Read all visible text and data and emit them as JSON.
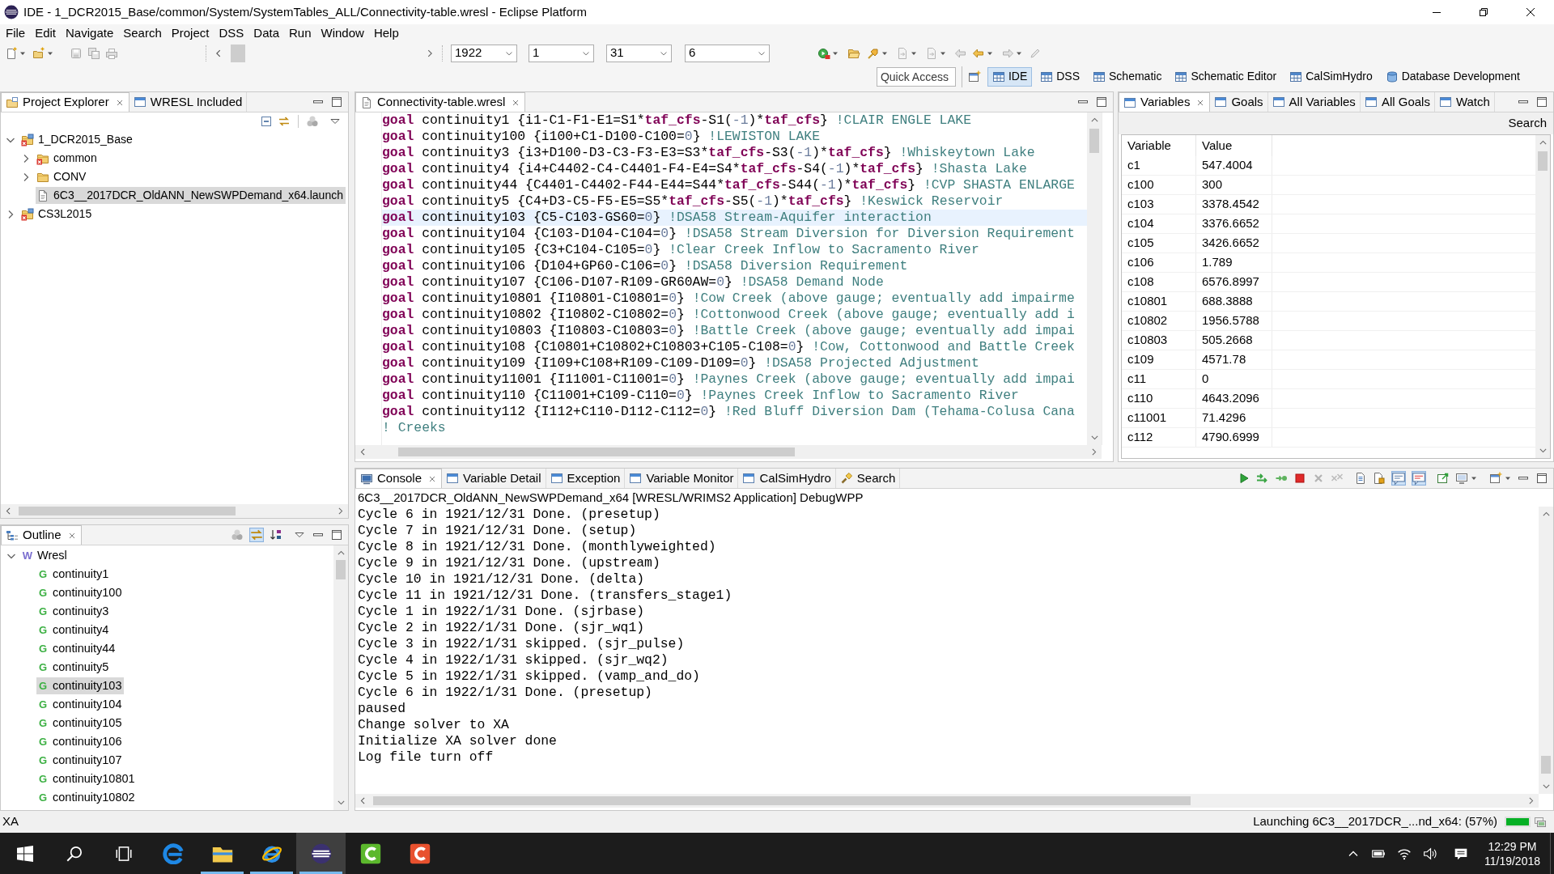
{
  "window": {
    "title": "IDE - 1_DCR2015_Base/common/System/SystemTables_ALL/Connectivity-table.wresl - Eclipse Platform"
  },
  "menu": [
    "File",
    "Edit",
    "Navigate",
    "Search",
    "Project",
    "DSS",
    "Data",
    "Run",
    "Window",
    "Help"
  ],
  "toolbar": {
    "combos": [
      "1922",
      "1",
      "31",
      "6"
    ]
  },
  "perspective_bar": {
    "quick_access": {
      "placeholder": "Quick Access"
    },
    "perspectives": [
      {
        "label": "IDE",
        "kind": "table",
        "selected": true
      },
      {
        "label": "DSS",
        "kind": "table",
        "selected": false
      },
      {
        "label": "Schematic",
        "kind": "table",
        "selected": false
      },
      {
        "label": "Schematic Editor",
        "kind": "table",
        "selected": false
      },
      {
        "label": "CalSimHydro",
        "kind": "table",
        "selected": false
      },
      {
        "label": "Database Development",
        "kind": "database",
        "selected": false
      }
    ]
  },
  "project_explorer": {
    "tabs": [
      {
        "label": "Project Explorer",
        "kind": "explorer",
        "selected": true
      },
      {
        "label": "WRESL Included",
        "kind": "view",
        "selected": false
      }
    ],
    "tree": [
      {
        "label": "1_DCR2015_Base",
        "kind": "project",
        "error": true,
        "expanded": true,
        "selected": false,
        "children": [
          {
            "label": "common",
            "kind": "folder",
            "error": true,
            "expanded": false,
            "selected": false
          },
          {
            "label": "CONV",
            "kind": "folder",
            "error": false,
            "expanded": false,
            "selected": false
          },
          {
            "label": "6C3__2017DCR_OldANN_NewSWPDemand_x64.launch",
            "kind": "file",
            "error": false,
            "selected": true
          }
        ]
      },
      {
        "label": "CS3L2015",
        "kind": "project",
        "error": true,
        "expanded": false,
        "selected": false
      }
    ]
  },
  "outline": {
    "tabs": [
      {
        "label": "Outline",
        "kind": "outline",
        "selected": true
      }
    ],
    "link_toggle": {
      "on": true
    },
    "tree": [
      {
        "label": "Wresl",
        "kind": "module",
        "icon": "W",
        "expanded": true,
        "selected": false,
        "children": [
          {
            "label": "continuity1",
            "kind": "goal",
            "icon": "G",
            "selected": false
          },
          {
            "label": "continuity100",
            "kind": "goal",
            "icon": "G",
            "selected": false
          },
          {
            "label": "continuity3",
            "kind": "goal",
            "icon": "G",
            "selected": false
          },
          {
            "label": "continuity4",
            "kind": "goal",
            "icon": "G",
            "selected": false
          },
          {
            "label": "continuity44",
            "kind": "goal",
            "icon": "G",
            "selected": false
          },
          {
            "label": "continuity5",
            "kind": "goal",
            "icon": "G",
            "selected": false
          },
          {
            "label": "continuity103",
            "kind": "goal",
            "icon": "G",
            "selected": true
          },
          {
            "label": "continuity104",
            "kind": "goal",
            "icon": "G",
            "selected": false
          },
          {
            "label": "continuity105",
            "kind": "goal",
            "icon": "G",
            "selected": false
          },
          {
            "label": "continuity106",
            "kind": "goal",
            "icon": "G",
            "selected": false
          },
          {
            "label": "continuity107",
            "kind": "goal",
            "icon": "G",
            "selected": false
          },
          {
            "label": "continuity10801",
            "kind": "goal",
            "icon": "G",
            "selected": false
          },
          {
            "label": "continuity10802",
            "kind": "goal",
            "icon": "G",
            "selected": false
          }
        ]
      }
    ]
  },
  "editor": {
    "tabs": [
      {
        "label": "Connectivity-table.wresl",
        "kind": "file",
        "selected": true
      }
    ],
    "lines": [
      {
        "current": false,
        "tokens": [
          {
            "kind": "keyword",
            "text": "goal"
          },
          {
            "kind": "code",
            "text": " continuity1 {i1-C1-F1-E1=S1*"
          },
          {
            "kind": "keyword",
            "text": "taf_cfs"
          },
          {
            "kind": "code",
            "text": "-S1("
          },
          {
            "kind": "number",
            "text": "-1"
          },
          {
            "kind": "code",
            "text": ")*"
          },
          {
            "kind": "keyword",
            "text": "taf_cfs"
          },
          {
            "kind": "code",
            "text": "} "
          },
          {
            "kind": "comment",
            "text": "!CLAIR ENGLE LAKE"
          }
        ]
      },
      {
        "current": false,
        "tokens": [
          {
            "kind": "keyword",
            "text": "goal"
          },
          {
            "kind": "code",
            "text": " continuity100 {i100+C1-D100-C100="
          },
          {
            "kind": "number",
            "text": "0"
          },
          {
            "kind": "code",
            "text": "} "
          },
          {
            "kind": "comment",
            "text": "!LEWISTON LAKE"
          }
        ]
      },
      {
        "current": false,
        "tokens": [
          {
            "kind": "keyword",
            "text": "goal"
          },
          {
            "kind": "code",
            "text": " continuity3 {i3+D100-D3-C3-F3-E3=S3*"
          },
          {
            "kind": "keyword",
            "text": "taf_cfs"
          },
          {
            "kind": "code",
            "text": "-S3("
          },
          {
            "kind": "number",
            "text": "-1"
          },
          {
            "kind": "code",
            "text": ")*"
          },
          {
            "kind": "keyword",
            "text": "taf_cfs"
          },
          {
            "kind": "code",
            "text": "} "
          },
          {
            "kind": "comment",
            "text": "!Whiskeytown Lake"
          }
        ]
      },
      {
        "current": false,
        "tokens": [
          {
            "kind": "keyword",
            "text": "goal"
          },
          {
            "kind": "code",
            "text": " continuity4 {i4+C4402-C4-C4401-F4-E4=S4*"
          },
          {
            "kind": "keyword",
            "text": "taf_cfs"
          },
          {
            "kind": "code",
            "text": "-S4("
          },
          {
            "kind": "number",
            "text": "-1"
          },
          {
            "kind": "code",
            "text": ")*"
          },
          {
            "kind": "keyword",
            "text": "taf_cfs"
          },
          {
            "kind": "code",
            "text": "} "
          },
          {
            "kind": "comment",
            "text": "!Shasta Lake"
          }
        ]
      },
      {
        "current": false,
        "tokens": [
          {
            "kind": "keyword",
            "text": "goal"
          },
          {
            "kind": "code",
            "text": " continuity44 {C4401-C4402-F44-E44=S44*"
          },
          {
            "kind": "keyword",
            "text": "taf_cfs"
          },
          {
            "kind": "code",
            "text": "-S44("
          },
          {
            "kind": "number",
            "text": "-1"
          },
          {
            "kind": "code",
            "text": ")*"
          },
          {
            "kind": "keyword",
            "text": "taf_cfs"
          },
          {
            "kind": "code",
            "text": "} "
          },
          {
            "kind": "comment",
            "text": "!CVP SHASTA ENLARGE"
          }
        ]
      },
      {
        "current": false,
        "tokens": [
          {
            "kind": "keyword",
            "text": "goal"
          },
          {
            "kind": "code",
            "text": " continuity5 {C4+D3-C5-F5-E5=S5*"
          },
          {
            "kind": "keyword",
            "text": "taf_cfs"
          },
          {
            "kind": "code",
            "text": "-S5("
          },
          {
            "kind": "number",
            "text": "-1"
          },
          {
            "kind": "code",
            "text": ")*"
          },
          {
            "kind": "keyword",
            "text": "taf_cfs"
          },
          {
            "kind": "code",
            "text": "} "
          },
          {
            "kind": "comment",
            "text": "!Keswick Reservoir"
          }
        ]
      },
      {
        "current": true,
        "tokens": [
          {
            "kind": "keyword",
            "text": "goal"
          },
          {
            "kind": "code",
            "text": " continuity103 {C5-C103-GS60="
          },
          {
            "kind": "number",
            "text": "0"
          },
          {
            "kind": "code",
            "text": "} "
          },
          {
            "kind": "comment",
            "text": "!DSA58 Stream-Aquifer interaction"
          }
        ]
      },
      {
        "current": false,
        "tokens": [
          {
            "kind": "keyword",
            "text": "goal"
          },
          {
            "kind": "code",
            "text": " continuity104 {C103-D104-C104="
          },
          {
            "kind": "number",
            "text": "0"
          },
          {
            "kind": "code",
            "text": "} "
          },
          {
            "kind": "comment",
            "text": "!DSA58 Stream Diversion for Diversion Requirement"
          }
        ]
      },
      {
        "current": false,
        "tokens": [
          {
            "kind": "keyword",
            "text": "goal"
          },
          {
            "kind": "code",
            "text": " continuity105 {C3+C104-C105="
          },
          {
            "kind": "number",
            "text": "0"
          },
          {
            "kind": "code",
            "text": "} "
          },
          {
            "kind": "comment",
            "text": "!Clear Creek Inflow to Sacramento River"
          }
        ]
      },
      {
        "current": false,
        "tokens": [
          {
            "kind": "keyword",
            "text": "goal"
          },
          {
            "kind": "code",
            "text": " continuity106 {D104+GP60-C106="
          },
          {
            "kind": "number",
            "text": "0"
          },
          {
            "kind": "code",
            "text": "} "
          },
          {
            "kind": "comment",
            "text": "!DSA58 Diversion Requirement"
          }
        ]
      },
      {
        "current": false,
        "tokens": [
          {
            "kind": "keyword",
            "text": "goal"
          },
          {
            "kind": "code",
            "text": " continuity107 {C106-D107-R109-GR60AW="
          },
          {
            "kind": "number",
            "text": "0"
          },
          {
            "kind": "code",
            "text": "} "
          },
          {
            "kind": "comment",
            "text": "!DSA58 Demand Node"
          }
        ]
      },
      {
        "current": false,
        "tokens": [
          {
            "kind": "keyword",
            "text": "goal"
          },
          {
            "kind": "code",
            "text": " continuity10801 {I10801-C10801="
          },
          {
            "kind": "number",
            "text": "0"
          },
          {
            "kind": "code",
            "text": "} "
          },
          {
            "kind": "comment",
            "text": "!Cow Creek (above gauge; eventually add impairme"
          }
        ]
      },
      {
        "current": false,
        "tokens": [
          {
            "kind": "keyword",
            "text": "goal"
          },
          {
            "kind": "code",
            "text": " continuity10802 {I10802-C10802="
          },
          {
            "kind": "number",
            "text": "0"
          },
          {
            "kind": "code",
            "text": "} "
          },
          {
            "kind": "comment",
            "text": "!Cottonwood Creek (above gauge; eventually add i"
          }
        ]
      },
      {
        "current": false,
        "tokens": [
          {
            "kind": "keyword",
            "text": "goal"
          },
          {
            "kind": "code",
            "text": " continuity10803 {I10803-C10803="
          },
          {
            "kind": "number",
            "text": "0"
          },
          {
            "kind": "code",
            "text": "} "
          },
          {
            "kind": "comment",
            "text": "!Battle Creek (above gauge; eventually add impai"
          }
        ]
      },
      {
        "current": false,
        "tokens": [
          {
            "kind": "keyword",
            "text": "goal"
          },
          {
            "kind": "code",
            "text": " continuity108 {C10801+C10802+C10803+C105-C108="
          },
          {
            "kind": "number",
            "text": "0"
          },
          {
            "kind": "code",
            "text": "} "
          },
          {
            "kind": "comment",
            "text": "!Cow, Cottonwood and Battle Creek"
          }
        ]
      },
      {
        "current": false,
        "tokens": [
          {
            "kind": "keyword",
            "text": "goal"
          },
          {
            "kind": "code",
            "text": " continuity109 {I109+C108+R109-C109-D109="
          },
          {
            "kind": "number",
            "text": "0"
          },
          {
            "kind": "code",
            "text": "} "
          },
          {
            "kind": "comment",
            "text": "!DSA58 Projected Adjustment"
          }
        ]
      },
      {
        "current": false,
        "tokens": [
          {
            "kind": "keyword",
            "text": "goal"
          },
          {
            "kind": "code",
            "text": " continuity11001 {I11001-C11001="
          },
          {
            "kind": "number",
            "text": "0"
          },
          {
            "kind": "code",
            "text": "} "
          },
          {
            "kind": "comment",
            "text": "!Paynes Creek (above gauge; eventually add impai"
          }
        ]
      },
      {
        "current": false,
        "tokens": [
          {
            "kind": "keyword",
            "text": "goal"
          },
          {
            "kind": "code",
            "text": " continuity110 {C11001+C109-C110="
          },
          {
            "kind": "number",
            "text": "0"
          },
          {
            "kind": "code",
            "text": "} "
          },
          {
            "kind": "comment",
            "text": "!Paynes Creek Inflow to Sacramento River"
          }
        ]
      },
      {
        "current": false,
        "tokens": [
          {
            "kind": "keyword",
            "text": "goal"
          },
          {
            "kind": "code",
            "text": " continuity112 {I112+C110-D112-C112="
          },
          {
            "kind": "number",
            "text": "0"
          },
          {
            "kind": "code",
            "text": "} "
          },
          {
            "kind": "comment",
            "text": "!Red Bluff Diversion Dam (Tehama-Colusa Cana"
          }
        ]
      },
      {
        "current": false,
        "tokens": [
          {
            "kind": "comment",
            "text": "! Creeks"
          }
        ]
      }
    ]
  },
  "variables": {
    "tabs": [
      {
        "label": "Variables",
        "kind": "view",
        "selected": true
      },
      {
        "label": "Goals",
        "kind": "view",
        "selected": false
      },
      {
        "label": "All Variables",
        "kind": "view",
        "selected": false
      },
      {
        "label": "All Goals",
        "kind": "view",
        "selected": false
      },
      {
        "label": "Watch",
        "kind": "view",
        "selected": false
      }
    ],
    "search": "Search",
    "table": {
      "columns": [
        "Variable",
        "Value"
      ],
      "rows": [
        {
          "variable": "c1",
          "value": "547.4004"
        },
        {
          "variable": "c100",
          "value": "300"
        },
        {
          "variable": "c103",
          "value": "3378.4542"
        },
        {
          "variable": "c104",
          "value": "3376.6652"
        },
        {
          "variable": "c105",
          "value": "3426.6652"
        },
        {
          "variable": "c106",
          "value": "1.789"
        },
        {
          "variable": "c108",
          "value": "6576.8997"
        },
        {
          "variable": "c10801",
          "value": "688.3888"
        },
        {
          "variable": "c10802",
          "value": "1956.5788"
        },
        {
          "variable": "c10803",
          "value": "505.2668"
        },
        {
          "variable": "c109",
          "value": "4571.78"
        },
        {
          "variable": "c11",
          "value": "0"
        },
        {
          "variable": "c110",
          "value": "4643.2096"
        },
        {
          "variable": "c11001",
          "value": "71.4296"
        },
        {
          "variable": "c112",
          "value": "4790.6999"
        }
      ]
    }
  },
  "console": {
    "tabs": [
      {
        "label": "Console",
        "kind": "console",
        "selected": true
      },
      {
        "label": "Variable Detail",
        "kind": "view",
        "selected": false
      },
      {
        "label": "Exception",
        "kind": "view",
        "selected": false
      },
      {
        "label": "Variable Monitor",
        "kind": "view",
        "selected": false
      },
      {
        "label": "CalSimHydro",
        "kind": "view",
        "selected": false
      },
      {
        "label": "Search",
        "kind": "search",
        "selected": false
      }
    ],
    "toggles": [
      {
        "kind": "stdout",
        "on": true
      },
      {
        "kind": "stderr",
        "on": true
      }
    ],
    "process": "6C3__2017DCR_OldANN_NewSWPDemand_x64 [WRESL/WRIMS2 Application] DebugWPP",
    "lines": [
      "Cycle 6 in 1921/12/31 Done. (presetup)",
      "Cycle 7 in 1921/12/31 Done. (setup)",
      "Cycle 8 in 1921/12/31 Done. (monthlyweighted)",
      "Cycle 9 in 1921/12/31 Done. (upstream)",
      "Cycle 10 in 1921/12/31 Done. (delta)",
      "Cycle 11 in 1921/12/31 Done. (transfers_stage1)",
      "Cycle 1 in 1922/1/31 Done. (sjrbase)",
      "Cycle 2 in 1922/1/31 Done. (sjr_wq1)",
      "Cycle 3 in 1922/1/31 skipped. (sjr_pulse)",
      "Cycle 4 in 1922/1/31 skipped. (sjr_wq2)",
      "Cycle 5 in 1922/1/31 skipped. (vamp_and_do)",
      "Cycle 6 in 1922/1/31 Done. (presetup)",
      "paused",
      "Change solver to XA",
      "Initialize XA solver done",
      "Log file turn off"
    ]
  },
  "status_bar": {
    "message": "XA",
    "progress_label": "Launching 6C3__2017DCR_...nd_x64: (57%)",
    "progress": {
      "level": 1
    }
  },
  "taskbar": {
    "apps": [
      {
        "kind": "edge",
        "running": false,
        "active": false
      },
      {
        "kind": "explorer",
        "running": true,
        "active": false
      },
      {
        "kind": "iexplore",
        "running": true,
        "active": false
      },
      {
        "kind": "eclipse",
        "running": true,
        "active": true
      },
      {
        "kind": "camtasia",
        "running": false,
        "active": false
      },
      {
        "kind": "recorder",
        "running": false,
        "active": false
      }
    ],
    "clock": {
      "time": "12:29 PM",
      "date": "11/19/2018"
    }
  }
}
